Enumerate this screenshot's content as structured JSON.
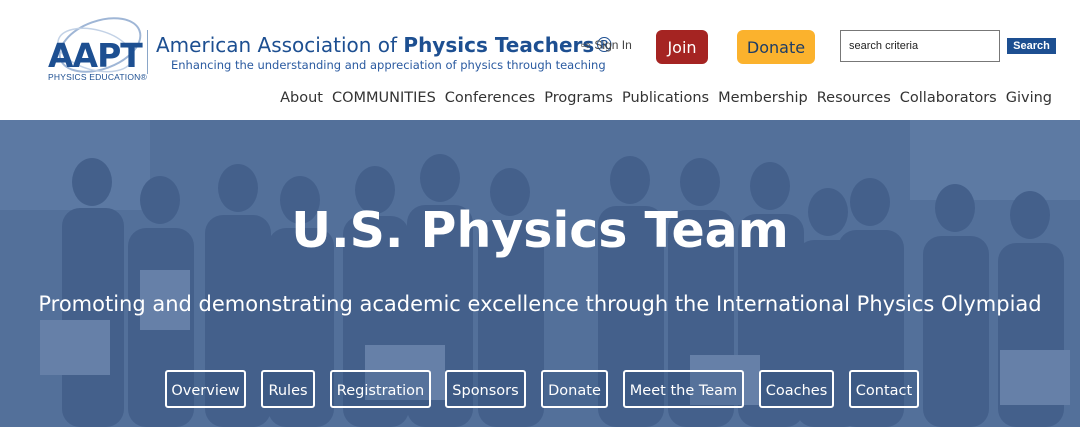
{
  "logo": {
    "mark": "AAPT",
    "subtitle": "PHYSICS EDUCATION",
    "registered": "®"
  },
  "org": {
    "name_prefix": "American Association of ",
    "name_bold": "Physics Teachers",
    "registered": "®",
    "tagline": "Enhancing the understanding and appreciation of physics through teaching"
  },
  "header": {
    "signin_label": "Sign In",
    "signin_icon": "sign-in-arrow-icon",
    "join_label": "Join",
    "donate_label": "Donate",
    "search_placeholder": "search criteria",
    "search_button": "Search"
  },
  "colors": {
    "brand_blue": "#1d4f91",
    "join_red": "#a52422",
    "donate_gold": "#fbb22d"
  },
  "nav": [
    "About",
    "COMMUNITIES",
    "Conferences",
    "Programs",
    "Publications",
    "Membership",
    "Resources",
    "Collaborators",
    "Giving"
  ],
  "hero": {
    "title": "U.S. Physics Team",
    "subtitle": "Promoting and demonstrating academic excellence through the International Physics Olympiad"
  },
  "subnav": [
    "Overview",
    "Rules",
    "Registration",
    "Sponsors",
    "Donate",
    "Meet the Team",
    "Coaches",
    "Contact"
  ]
}
